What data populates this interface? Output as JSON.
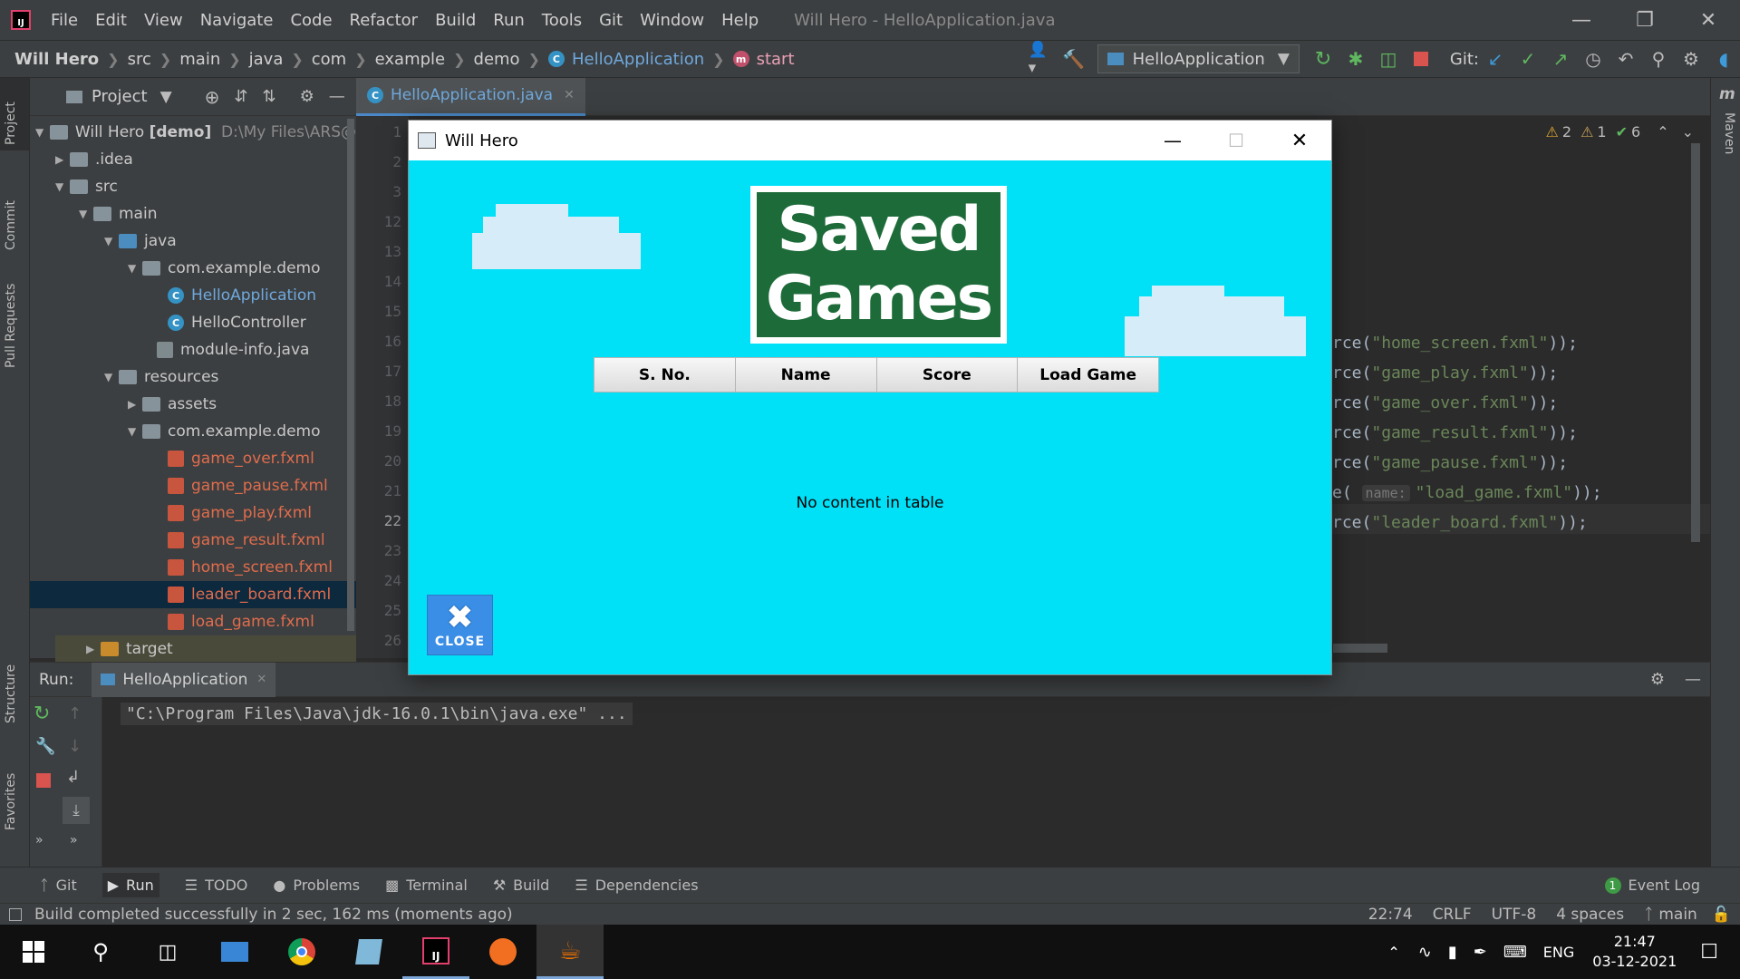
{
  "ide": {
    "window_title": "Will Hero - HelloApplication.java",
    "menu": [
      "File",
      "Edit",
      "View",
      "Navigate",
      "Code",
      "Refactor",
      "Build",
      "Run",
      "Tools",
      "Git",
      "Window",
      "Help"
    ],
    "breadcrumb": [
      "Will Hero",
      "src",
      "main",
      "java",
      "com",
      "example",
      "demo",
      "HelloApplication",
      "start"
    ],
    "run_config": "HelloApplication",
    "git_label": "Git:"
  },
  "left_strip": [
    "Project",
    "Commit",
    "Pull Requests",
    "Structure",
    "Favorites"
  ],
  "right_strip": [
    "Maven"
  ],
  "project": {
    "header": "Project",
    "root_name": "Will Hero",
    "root_module": "[demo]",
    "root_path": "D:\\My Files\\ARS@",
    "tree": [
      {
        "label": "idea",
        "prefix": "."
      },
      {
        "label": "src"
      },
      {
        "label": "main"
      },
      {
        "label": "java"
      },
      {
        "label": "com.example.demo"
      },
      {
        "label": "HelloApplication"
      },
      {
        "label": "HelloController"
      },
      {
        "label": "module-info.java"
      },
      {
        "label": "resources"
      },
      {
        "label": "assets"
      },
      {
        "label": "com.example.demo"
      },
      {
        "label": "game_over.fxml"
      },
      {
        "label": "game_pause.fxml"
      },
      {
        "label": "game_play.fxml"
      },
      {
        "label": "game_result.fxml"
      },
      {
        "label": "home_screen.fxml"
      },
      {
        "label": "leader_board.fxml"
      },
      {
        "label": "load_game.fxml"
      },
      {
        "label": "target"
      }
    ]
  },
  "editor": {
    "tab": "HelloApplication.java",
    "line_numbers": [
      "1",
      "2",
      "3",
      "12",
      "13",
      "14",
      "15",
      "16",
      "17",
      "18",
      "19",
      "20",
      "21",
      "22",
      "23",
      "24",
      "25",
      "26"
    ],
    "inspections": {
      "warnings": "2",
      "weak": "1",
      "ok": "6"
    },
    "code_lines": [
      {
        "pre": "rce(",
        "str": "\"home_screen.fxml\"",
        "post": "));"
      },
      {
        "pre": "rce(",
        "str": "\"game_play.fxml\"",
        "post": "));"
      },
      {
        "pre": "rce(",
        "str": "\"game_over.fxml\"",
        "post": "));"
      },
      {
        "pre": "rce(",
        "str": "\"game_result.fxml\"",
        "post": "));"
      },
      {
        "pre": "rce(",
        "str": "\"game_pause.fxml\"",
        "post": "));"
      },
      {
        "pre": "e( ",
        "hint": "name:",
        "str": "\"load_game.fxml\"",
        "post": "));"
      },
      {
        "pre": "rce(",
        "str": "\"leader_board.fxml\"",
        "post": "));"
      }
    ]
  },
  "hero_window": {
    "title": "Will Hero",
    "logo_line1": "Saved",
    "logo_line2": "Games",
    "columns": [
      "S. No.",
      "Name",
      "Score",
      "Load Game"
    ],
    "empty_message": "No content in table",
    "close_label": "CLOSE"
  },
  "run_panel": {
    "label": "Run:",
    "tab": "HelloApplication",
    "console_line": "\"C:\\Program Files\\Java\\jdk-16.0.1\\bin\\java.exe\" ..."
  },
  "bottom_tools": [
    "Git",
    "Run",
    "TODO",
    "Problems",
    "Terminal",
    "Build",
    "Dependencies"
  ],
  "event_log": "Event Log",
  "event_count": "1",
  "status": {
    "message": "Build completed successfully in 2 sec, 162 ms (moments ago)",
    "position": "22:74",
    "line_sep": "CRLF",
    "encoding": "UTF-8",
    "indent": "4 spaces",
    "branch": "main"
  },
  "taskbar": {
    "lang": "ENG",
    "time": "21:47",
    "date": "03-12-2021"
  }
}
